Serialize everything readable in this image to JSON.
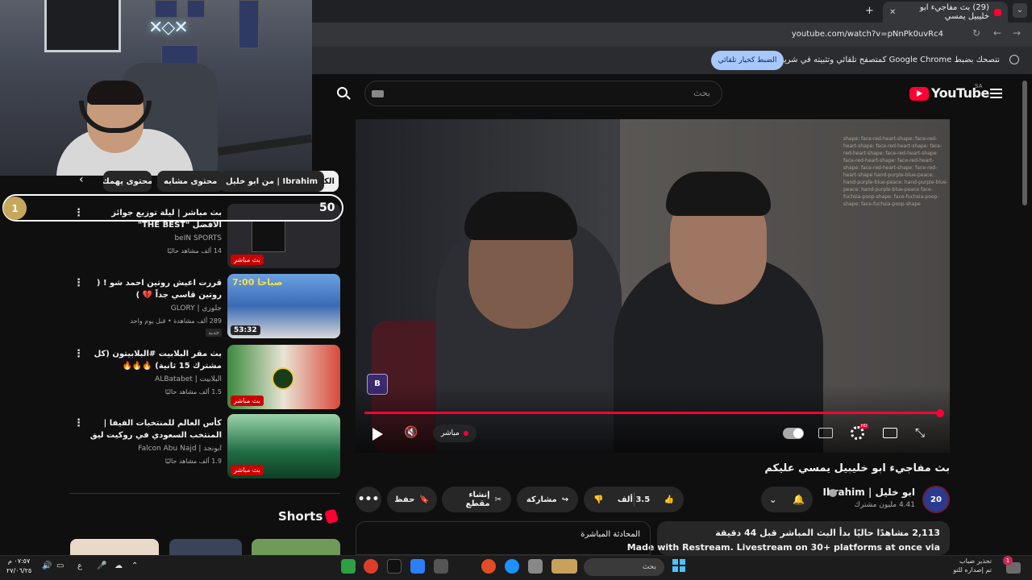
{
  "browser": {
    "tab_title": "(29) بث مفاجيء ابو خليبيل يمسي",
    "tab_close": "✕",
    "new_tab": "+",
    "tab_menu": "⌄",
    "url": "youtube.com/watch?v=pNnPk0uvRc4",
    "infobar_text": "نتصحك بضبط Google Chrome كمتصفح تلقائي وتثبيته في شريط المهام",
    "infobar_button": "الضبط كخيار تلقائي"
  },
  "youtube": {
    "logo_text": "YouTube",
    "region": "SA",
    "search_placeholder": "بحث"
  },
  "chips": {
    "all": "الكل",
    "from": "من ابو خليل | Ibrahim",
    "related": "محتوى مشابه",
    "more": "محتوى يهمك",
    "arrow": "‹"
  },
  "overlay": {
    "rank": "1",
    "score": "50"
  },
  "recommendations": [
    {
      "title": "بث مباشر | ليلة توزيع جوائز الأفضل \"THE BEST\"",
      "channel": "beIN SPORTS",
      "meta": "14 ألف مشاهد حاليًا",
      "badge": "بث مباشر",
      "thumb_color": "#2a2a2e"
    },
    {
      "title": "قررت اعيش روتين احمد شو ! ( روتين قاسي جداً 💔 )",
      "channel": "جلوري | GLORY",
      "meta": "289 ألف مشاهدة • قبل يوم واحد",
      "new_label": "جديد",
      "duration": "53:32",
      "thumb_color": "#3a6bb5"
    },
    {
      "title": "بث مقر البلابيت #البلابيتون (كل مشترك 15 ثانية) 🔥🔥🔥",
      "channel": "البلابيت | ALBatabet",
      "meta": "1.5 ألف مشاهد حاليًا",
      "badge": "بث مباشر",
      "thumb_color": "#3b8a3e"
    },
    {
      "title": "كأس العالم للمنتخبات الفيفا | المنتخب السعودي في روكيت ليق",
      "channel": "ابونجد | Falcon Abu Najd",
      "meta": "1.9 ألف مشاهد حاليًا",
      "badge": "بث مباشر",
      "thumb_color": "#1f6b43"
    }
  ],
  "shorts": {
    "label": "Shorts"
  },
  "player": {
    "logo": "B",
    "live_label": "مباشر",
    "mute_icon": "🔇",
    "fullscreen_icon": "⤡",
    "progress": 1.0,
    "chat_text": "shape: face-red-heart-shape: face-red-heart-shape: face-red-heart-shape: face-red-heart-shape: face-red-heart-shape: face-red-heart-shape: face-red-heart-shape: face-red-heart-shape: face-red-heart-shape hand-purple-blue-peace: hand-purple-blue-peace: hand-purple-blue-peace: hand-purple-blue-peace face-fuchsia-poop-shape: face-fuchsia-poop-shape: face-fuchsia-poop-shape"
  },
  "video": {
    "title": "بث مفاجيء ابو خليبيل يمسي عليكم",
    "channel": "ابو خليل | Ibrahim",
    "subscribers": "4.41 مليون مشترك",
    "avatar_text": "20",
    "likes": "3.5 ألف",
    "share": "مشاركة",
    "clip": "إنشاء مقطع",
    "save": "حفظ",
    "more": "•••",
    "bell_icon": "🔔",
    "chevron": "⌄",
    "like_icon": "👍",
    "dislike_icon": "👎"
  },
  "description": {
    "views": "2,113 مشاهدًا حاليًا  بدأ البث المباشر قبل 44 دقيقة",
    "line": "Made with Restream. Livestream on 30+ platforms at once via"
  },
  "live_chat": {
    "title": "المحادثة المباشرة"
  },
  "taskbar": {
    "time": "٠٧:٥٧ م",
    "date": "٢٧/٠٦/٢٥",
    "search": "بحث",
    "lang": "ع",
    "notify_title": "تحذير ضباب",
    "notify_sub": "تم إصداره للتو",
    "notify_count": "1",
    "colors": [
      "#2ea043",
      "#dd3e2a",
      "#111111",
      "#2d7ff9",
      "#555555",
      "#e34c26",
      "#1e90ff",
      "#888888",
      "#c8a25a"
    ]
  }
}
